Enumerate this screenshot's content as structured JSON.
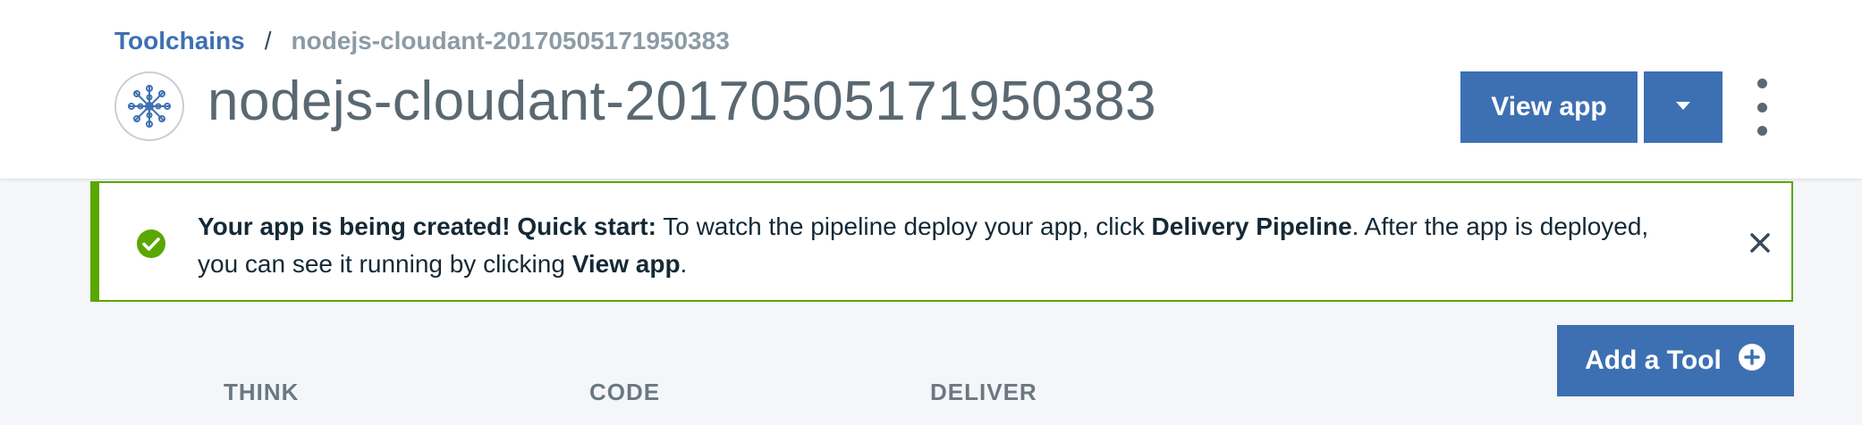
{
  "breadcrumb": {
    "parent": "Toolchains",
    "separator": "/",
    "current": "nodejs-cloudant-20170505171950383"
  },
  "header": {
    "title": "nodejs-cloudant-20170505171950383",
    "icon": "toolchain-icon",
    "view_app_label": "View app",
    "dropdown_icon": "caret-down-icon",
    "overflow_icon": "kebab-icon"
  },
  "notification": {
    "status": "success",
    "status_icon": "checkmark-icon",
    "status_color": "#5aa700",
    "heading": "Your app is being created! Quick start:",
    "text1": " To watch the pipeline deploy your app, click ",
    "link1": "Delivery Pipeline",
    "text2": ". After the app is deployed, you can see it running by clicking ",
    "link2": "View app",
    "text3": ".",
    "close_icon": "close-icon"
  },
  "actions": {
    "add_tool_label": "Add a Tool",
    "add_tool_icon": "plus-circle-icon"
  },
  "columns": [
    "THINK",
    "CODE",
    "DELIVER"
  ],
  "colors": {
    "accent": "#3d70b2",
    "success": "#5aa700",
    "title": "#5a6872"
  }
}
